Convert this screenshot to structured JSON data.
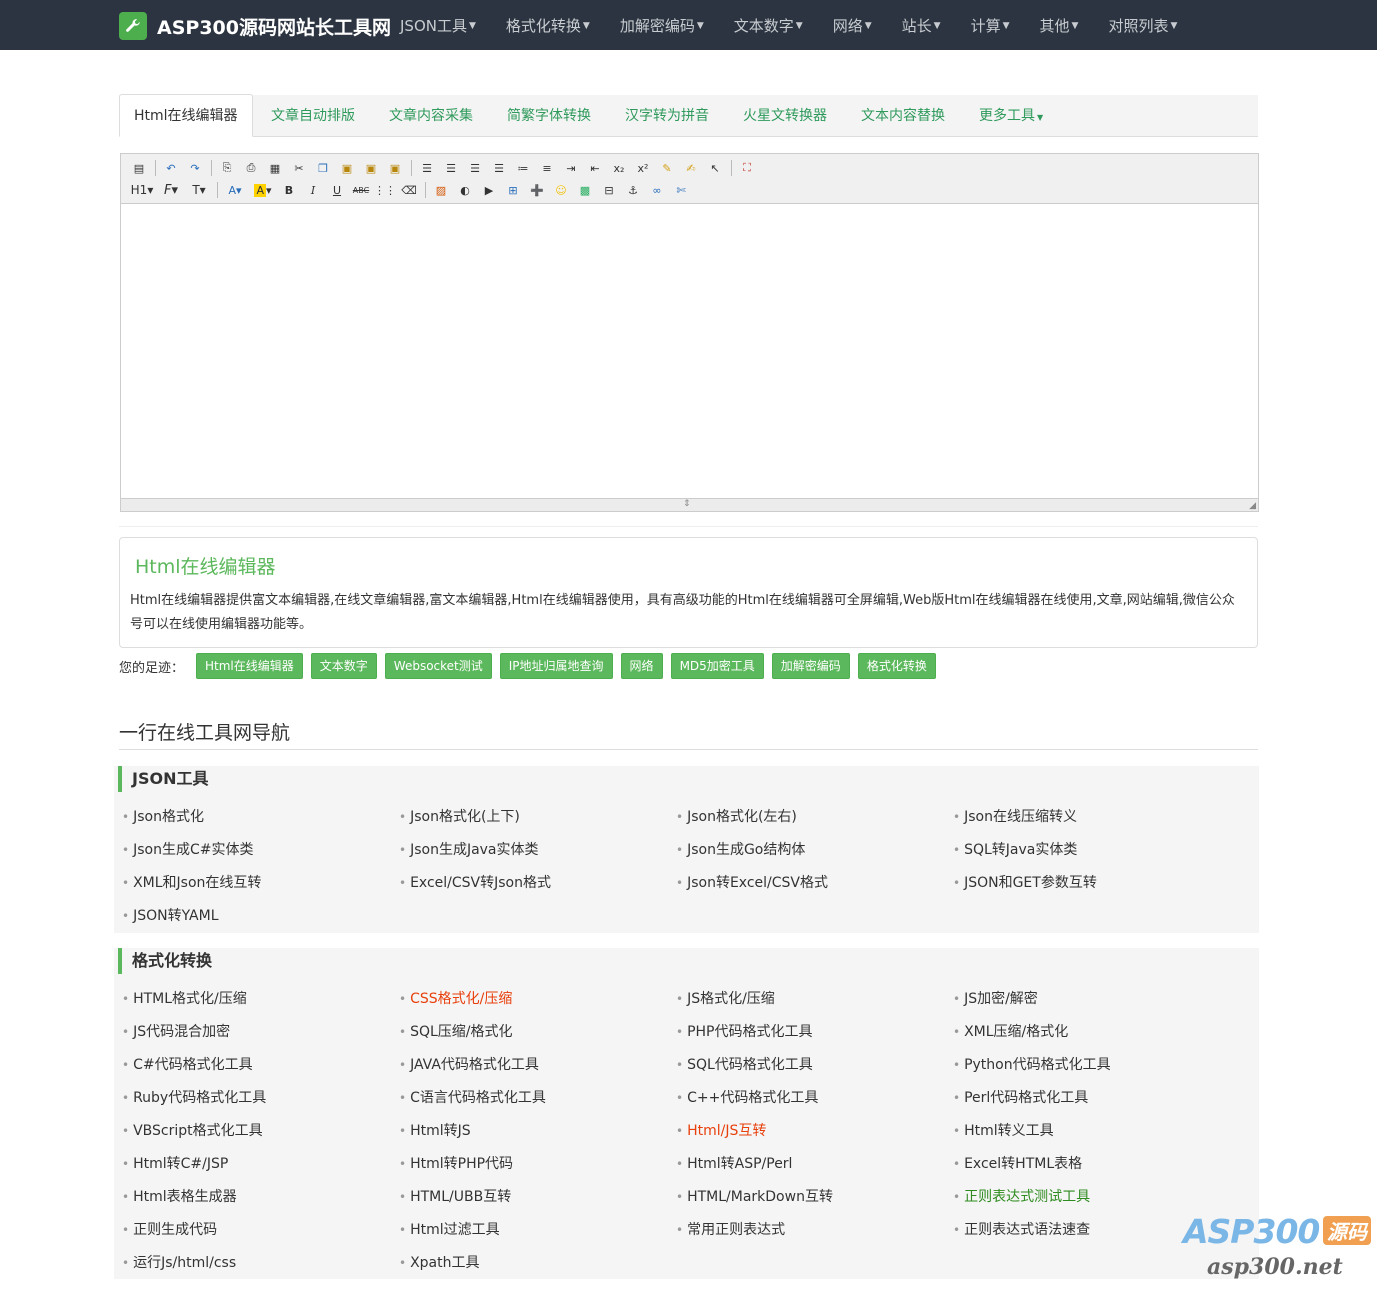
{
  "header": {
    "brand": "ASP300源码网站长工具网",
    "nav": [
      "JSON工具",
      "格式化转换",
      "加解密编码",
      "文本数字",
      "网络",
      "站长",
      "计算",
      "其他",
      "对照列表"
    ]
  },
  "tabs": [
    "Html在线编辑器",
    "文章自动排版",
    "文章内容采集",
    "简繁字体转换",
    "汉字转为拼音",
    "火星文转换器",
    "文本内容替换",
    "更多工具"
  ],
  "editor": {
    "row2_labels": {
      "heading": "H1",
      "font_family": "F",
      "font_size": "T",
      "font_color": "A",
      "highlight": "A",
      "bold": "B",
      "italic": "I",
      "underline": "U",
      "strike": "ABC"
    }
  },
  "info": {
    "title": "Html在线编辑器",
    "desc": "Html在线编辑器提供富文本编辑器,在线文章编辑器,富文本编辑器,Html在线编辑器使用，具有高级功能的Html在线编辑器可全屏编辑,Web版Html在线编辑器在线使用,文章,网站编辑,微信公众号可以在线使用编辑器功能等。"
  },
  "footprint": {
    "label": "您的足迹：",
    "items": [
      "Html在线编辑器",
      "文本数字",
      "Websocket测试",
      "IP地址归属地查询",
      "网络",
      "MD5加密工具",
      "加解密编码",
      "格式化转换"
    ]
  },
  "nav_title": "一行在线工具网导航",
  "sections": [
    {
      "title": "JSON工具",
      "links": [
        {
          "text": "Json格式化"
        },
        {
          "text": "Json格式化(上下)"
        },
        {
          "text": "Json格式化(左右)"
        },
        {
          "text": "Json在线压缩转义"
        },
        {
          "text": "Json生成C#实体类"
        },
        {
          "text": "Json生成Java实体类"
        },
        {
          "text": "Json生成Go结构体"
        },
        {
          "text": "SQL转Java实体类"
        },
        {
          "text": "XML和Json在线互转"
        },
        {
          "text": "Excel/CSV转Json格式"
        },
        {
          "text": "Json转Excel/CSV格式"
        },
        {
          "text": "JSON和GET参数互转"
        },
        {
          "text": "JSON转YAML"
        }
      ]
    },
    {
      "title": "格式化转换",
      "links": [
        {
          "text": "HTML格式化/压缩"
        },
        {
          "text": "CSS格式化/压缩",
          "color": "#e8400c"
        },
        {
          "text": "JS格式化/压缩"
        },
        {
          "text": "JS加密/解密"
        },
        {
          "text": "JS代码混合加密"
        },
        {
          "text": "SQL压缩/格式化"
        },
        {
          "text": "PHP代码格式化工具"
        },
        {
          "text": "XML压缩/格式化"
        },
        {
          "text": "C#代码格式化工具"
        },
        {
          "text": "JAVA代码格式化工具"
        },
        {
          "text": "SQL代码格式化工具"
        },
        {
          "text": "Python代码格式化工具"
        },
        {
          "text": "Ruby代码格式化工具"
        },
        {
          "text": "C语言代码格式化工具"
        },
        {
          "text": "C++代码格式化工具"
        },
        {
          "text": "Perl代码格式化工具"
        },
        {
          "text": "VBScript格式化工具"
        },
        {
          "text": "Html转JS"
        },
        {
          "text": "Html/JS互转",
          "color": "#e8400c"
        },
        {
          "text": "Html转义工具"
        },
        {
          "text": "Html转C#/JSP"
        },
        {
          "text": "Html转PHP代码"
        },
        {
          "text": "Html转ASP/Perl"
        },
        {
          "text": "Excel转HTML表格"
        },
        {
          "text": "Html表格生成器"
        },
        {
          "text": "HTML/UBB互转"
        },
        {
          "text": "HTML/MarkDown互转"
        },
        {
          "text": "正则表达式测试工具",
          "color": "#2e8b1f"
        },
        {
          "text": "正则生成代码"
        },
        {
          "text": "Html过滤工具"
        },
        {
          "text": "常用正则表达式"
        },
        {
          "text": "正则表达式语法速查"
        },
        {
          "text": "运行Js/html/css"
        },
        {
          "text": "Xpath工具"
        }
      ]
    }
  ],
  "watermark": {
    "brand": "ASP300",
    "tag": "源码",
    "url": "asp300.net"
  }
}
